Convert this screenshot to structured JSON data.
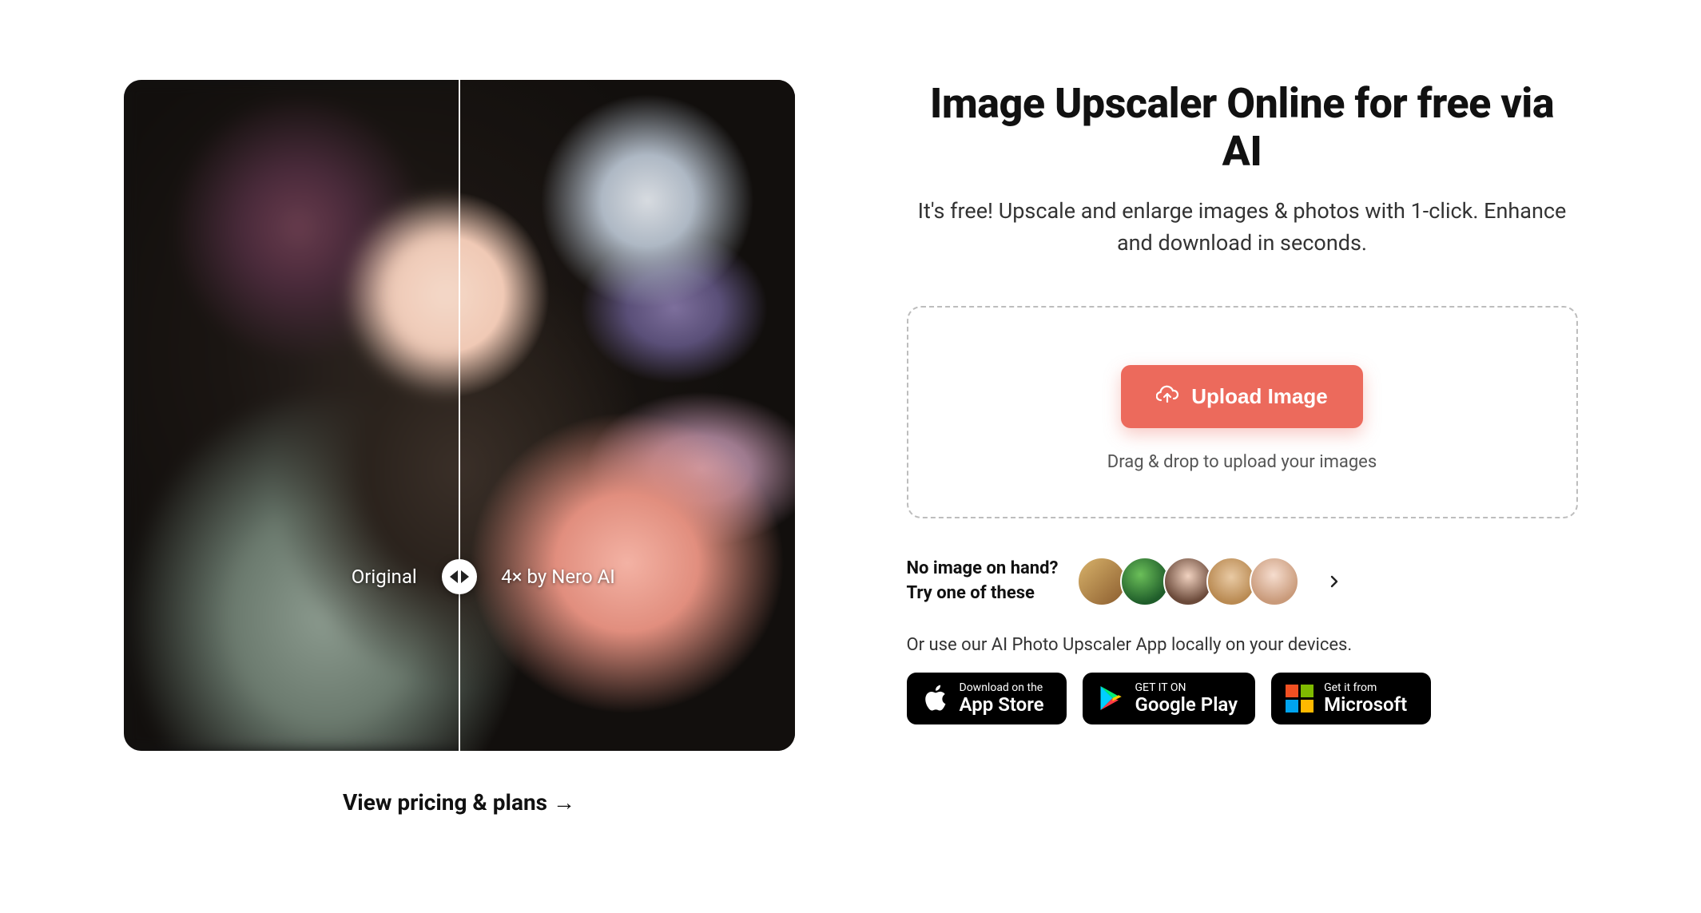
{
  "hero": {
    "headline": "Image Upscaler Online for free via AI",
    "subhead": "It's free! Upscale and enlarge images & photos with 1-click. Enhance and download in seconds."
  },
  "compare": {
    "left_label": "Original",
    "right_label": "4× by Nero AI"
  },
  "pricing_link": "View pricing & plans →",
  "upload": {
    "button_label": "Upload Image",
    "hint": "Drag & drop to upload your images"
  },
  "samples": {
    "line1": "No image on hand?",
    "line2": "Try one of these"
  },
  "local_line": "Or use our AI Photo Upscaler App locally on your devices.",
  "stores": {
    "apple": {
      "small": "Download on the",
      "big": "App Store"
    },
    "google": {
      "small": "GET IT ON",
      "big": "Google Play"
    },
    "microsoft": {
      "small": "Get it from",
      "big": "Microsoft"
    }
  }
}
